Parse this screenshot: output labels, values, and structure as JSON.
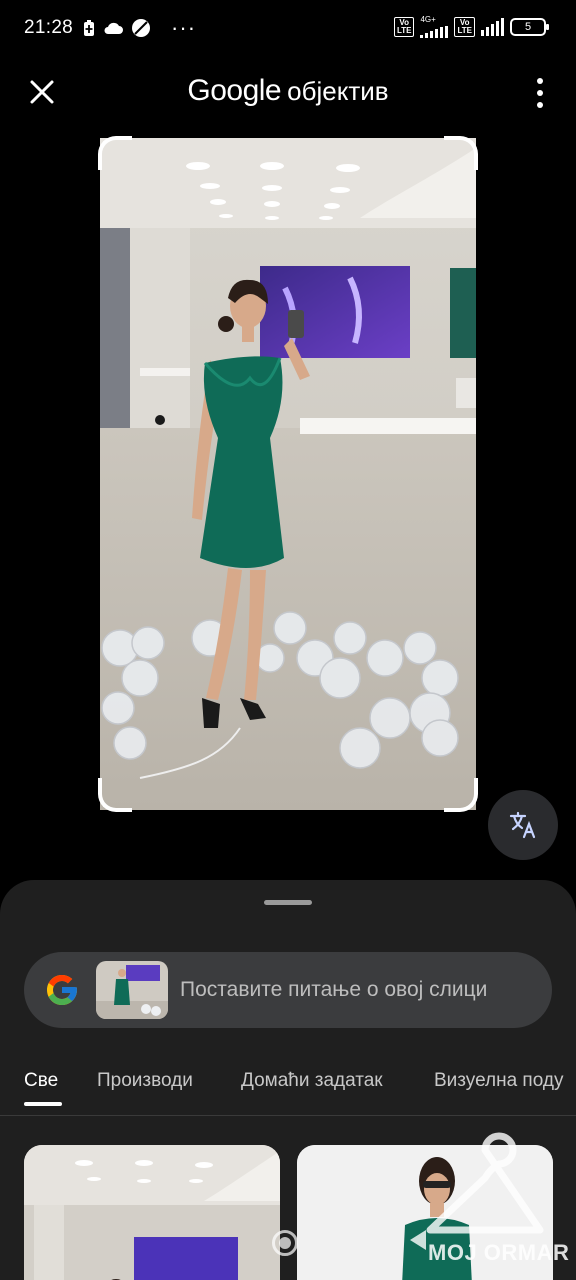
{
  "status_bar": {
    "time": "21:28",
    "overflow": "···",
    "volte1": "Vo\nLTE",
    "net_type": "4G+",
    "volte2": "Vo\nLTE",
    "battery": "5",
    "icons": [
      "battery-saver-icon",
      "cloud-icon",
      "no-data-icon",
      "signal-icon"
    ]
  },
  "header": {
    "brand": "Google",
    "subtitle": "објектив",
    "close_icon": "close-icon",
    "more_icon": "more-vert-icon"
  },
  "translate_button": {
    "icon": "translate-icon"
  },
  "search": {
    "placeholder": "Поставите питање о овој слици",
    "logo": "google-g-icon"
  },
  "tabs": [
    {
      "label": "Све",
      "active": true
    },
    {
      "label": "Производи",
      "active": false
    },
    {
      "label": "Домаћи задатак",
      "active": false
    },
    {
      "label": "Визуелна поду",
      "active": false
    }
  ],
  "watermark": {
    "text": "MOJ ORMAR"
  },
  "colors": {
    "background": "#000000",
    "sheet": "#1f1f1f",
    "search_bar": "#3b3c3e",
    "dress": "#0f6b57"
  }
}
